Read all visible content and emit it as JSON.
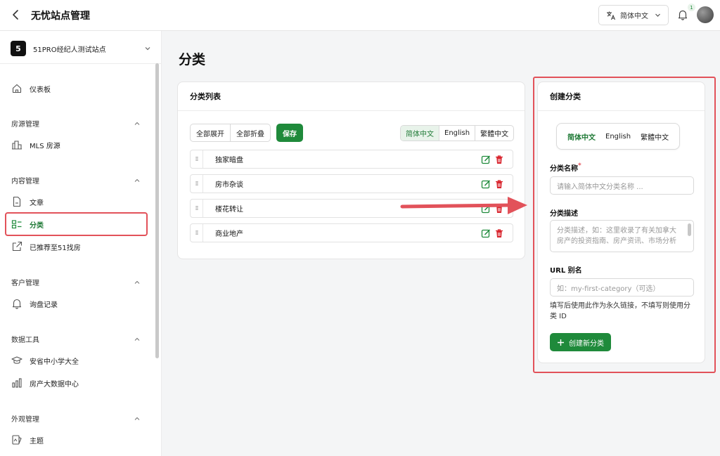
{
  "header": {
    "title": "无忧站点管理",
    "language": "简体中文",
    "notification_count": "1"
  },
  "sidebar": {
    "site_badge": "5",
    "site_name": "51PRO经纪人测试站点",
    "dashboard": "仪表板",
    "groups": [
      {
        "title": "房源管理",
        "items": [
          "MLS 房源"
        ]
      },
      {
        "title": "内容管理",
        "items": [
          "文章",
          "分类",
          "已推荐至51找房"
        ]
      },
      {
        "title": "客户管理",
        "items": [
          "询盘记录"
        ]
      },
      {
        "title": "数据工具",
        "items": [
          "安省中小学大全",
          "房产大数据中心"
        ]
      },
      {
        "title": "外观管理",
        "items": [
          "主题"
        ]
      }
    ],
    "active_item": "分类"
  },
  "page": {
    "title": "分类"
  },
  "category_list": {
    "title": "分类列表",
    "expand_all": "全部展开",
    "collapse_all": "全部折叠",
    "save": "保存",
    "languages": [
      "简体中文",
      "English",
      "繁體中文"
    ],
    "selected_language": "简体中文",
    "items": [
      "独家暗盘",
      "房市杂谈",
      "楼花转让",
      "商业地产"
    ]
  },
  "create_form": {
    "title": "创建分类",
    "languages": [
      "简体中文",
      "English",
      "繁體中文"
    ],
    "selected_language": "简体中文",
    "name_label": "分类名称",
    "required_mark": "*",
    "name_placeholder": "请输入简体中文分类名称 ...",
    "desc_label": "分类描述",
    "desc_placeholder": "分类描述，如：这里收录了有关加拿大房产的投资指南、房产资讯、市场分析",
    "slug_label": "URL 别名",
    "slug_placeholder": "如：my-first-category（可选）",
    "slug_hint": "填写后使用此作为永久链接，不填写则使用分类 ID",
    "submit": "创建新分类"
  },
  "colors": {
    "accent": "#1f8a3b",
    "highlight": "#e2525a",
    "delete": "#d9262f"
  }
}
